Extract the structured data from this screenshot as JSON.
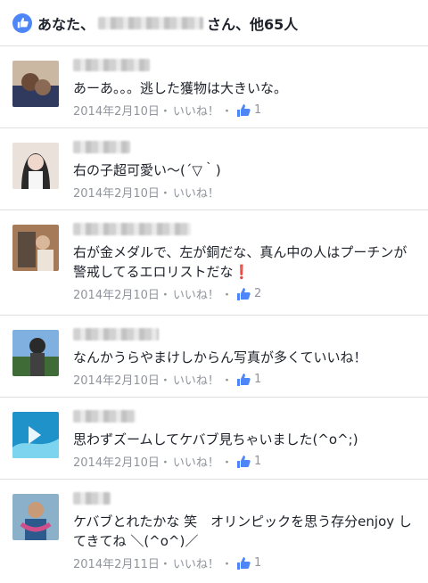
{
  "likes": {
    "prefix": "あなた、",
    "suffix": "さん、他65人"
  },
  "comments": [
    {
      "text": "あーあ。。。逃した獲物は大きいな。",
      "date": "2014年2月10日",
      "like_label": "いいね！",
      "like_count": "1",
      "avatar_colors": [
        "#6b4a38",
        "#2f3a5e"
      ]
    },
    {
      "text": "右の子超可愛い〜(´▽｀)",
      "date": "2014年2月10日",
      "like_label": "いいね！",
      "like_count": "",
      "avatar_colors": [
        "#f0d7cc",
        "#2a2a2a"
      ]
    },
    {
      "text": "右が金メダルで、左が銅だな、真ん中の人はプーチンが警戒してるエロリストだな",
      "text_emoji": "❗",
      "date": "2014年2月10日",
      "like_label": "いいね！",
      "like_count": "2",
      "avatar_colors": [
        "#5a4b3e",
        "#a47a58"
      ]
    },
    {
      "text": "なんかうらやまけしからん写真が多くていいね！",
      "date": "2014年2月10日",
      "like_label": "いいね！",
      "like_count": "1",
      "avatar_colors": [
        "#4d7fbf",
        "#3f6b36"
      ]
    },
    {
      "text": "思わずズームしてケバブ見ちゃいました(^o^;)",
      "date": "2014年2月10日",
      "like_label": "いいね！",
      "like_count": "1",
      "avatar_colors": [
        "#1f93c9",
        "#7dd4ef"
      ]
    },
    {
      "text": "ケバブとれたかな 笑　オリンピックを思う存分enjoy してきてね ＼(^o^)／",
      "date": "2014年2月11日",
      "like_label": "いいね！",
      "like_count": "1",
      "avatar_colors": [
        "#2d5a8c",
        "#d04f8b"
      ]
    }
  ],
  "icons": {
    "like_badge": "thumbs-up-icon",
    "thumb": "thumbs-up-icon"
  },
  "colors": {
    "accent": "#4f86f7",
    "meta": "#90949c"
  }
}
